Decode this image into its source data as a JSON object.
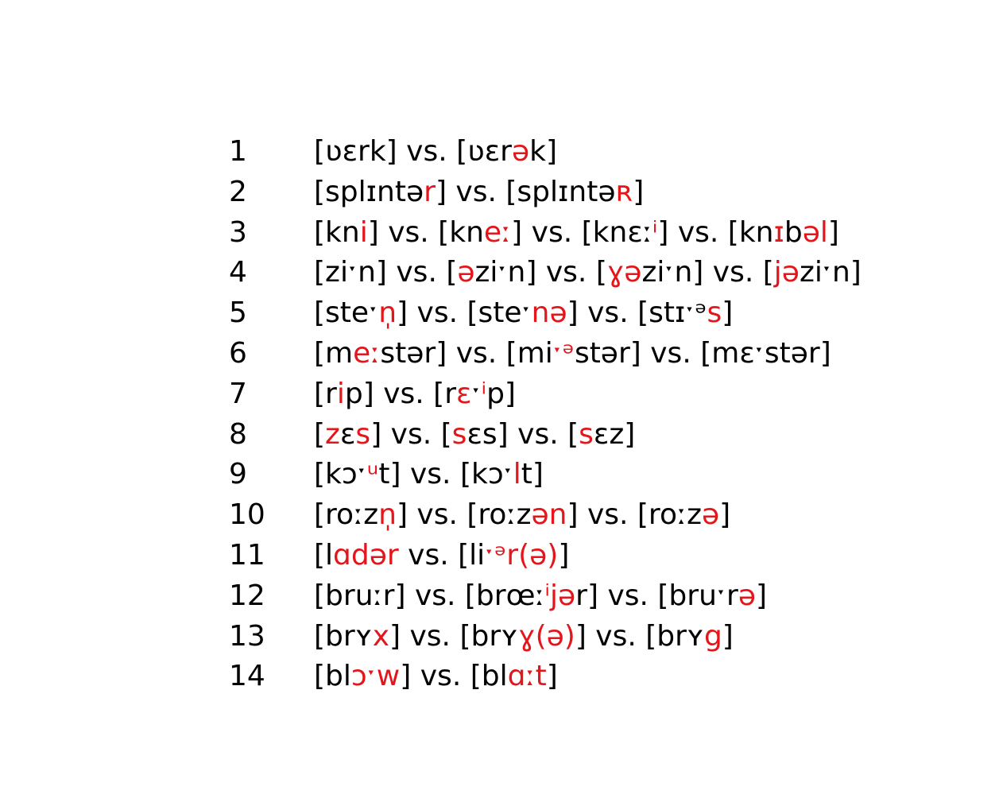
{
  "highlight_color": "#e4161b",
  "text_color": "#000000",
  "rows": [
    {
      "n": "1",
      "segs": [
        [
          "[ʋɛrk]",
          0
        ],
        [
          " vs. ",
          0
        ],
        [
          "[ʋɛr",
          0
        ],
        [
          "ə",
          1
        ],
        [
          "k]",
          0
        ]
      ]
    },
    {
      "n": "2",
      "segs": [
        [
          "[splɪntə",
          0
        ],
        [
          "r",
          1
        ],
        [
          "]",
          0
        ],
        [
          " vs. ",
          0
        ],
        [
          "[splɪntə",
          0
        ],
        [
          "ʀ",
          1
        ],
        [
          "]",
          0
        ]
      ]
    },
    {
      "n": "3",
      "segs": [
        [
          "[kn",
          0
        ],
        [
          "i",
          1
        ],
        [
          "]",
          0
        ],
        [
          " vs. ",
          0
        ],
        [
          "[kn",
          0
        ],
        [
          "eː",
          1
        ],
        [
          "]",
          0
        ],
        [
          " vs. ",
          0
        ],
        [
          "[knɛː",
          0
        ],
        [
          "ⁱ",
          1
        ],
        [
          "]",
          0
        ],
        [
          " vs. ",
          0
        ],
        [
          "[kn",
          0
        ],
        [
          "ɪ",
          1
        ],
        [
          "b",
          0
        ],
        [
          "əl",
          1
        ],
        [
          "]",
          0
        ]
      ]
    },
    {
      "n": "4",
      "segs": [
        [
          "[ziˑn]",
          0
        ],
        [
          " vs. ",
          0
        ],
        [
          "[",
          0
        ],
        [
          "ə",
          1
        ],
        [
          "ziˑn]",
          0
        ],
        [
          " vs. ",
          0
        ],
        [
          "[",
          0
        ],
        [
          "ɣə",
          1
        ],
        [
          "ziˑn]",
          0
        ],
        [
          " vs. ",
          0
        ],
        [
          "[",
          0
        ],
        [
          "jə",
          1
        ],
        [
          "ziˑn]",
          0
        ]
      ]
    },
    {
      "n": "5",
      "segs": [
        [
          "[steˑ",
          0
        ],
        [
          "n̩",
          1
        ],
        [
          "]",
          0
        ],
        [
          " vs. ",
          0
        ],
        [
          "[steˑ",
          0
        ],
        [
          "nə",
          1
        ],
        [
          "]",
          0
        ],
        [
          " vs. ",
          0
        ],
        [
          "[stɪˑᵊ",
          0
        ],
        [
          "s",
          1
        ],
        [
          "]",
          0
        ]
      ]
    },
    {
      "n": "6",
      "segs": [
        [
          "[m",
          0
        ],
        [
          "eː",
          1
        ],
        [
          "stər]",
          0
        ],
        [
          " vs. ",
          0
        ],
        [
          "[mi",
          0
        ],
        [
          "ˑᵊ",
          1
        ],
        [
          "stər]",
          0
        ],
        [
          " vs. ",
          0
        ],
        [
          "[mɛˑstər]",
          0
        ]
      ]
    },
    {
      "n": "7",
      "segs": [
        [
          "[r",
          0
        ],
        [
          "i",
          1
        ],
        [
          "p]",
          0
        ],
        [
          " vs. ",
          0
        ],
        [
          "[r",
          0
        ],
        [
          "ɛ",
          1
        ],
        [
          "ˑ",
          0
        ],
        [
          "ⁱ",
          1
        ],
        [
          "p]",
          0
        ]
      ]
    },
    {
      "n": "8",
      "segs": [
        [
          "[",
          0
        ],
        [
          "z",
          1
        ],
        [
          "ɛ",
          0
        ],
        [
          "s",
          1
        ],
        [
          "]",
          0
        ],
        [
          " vs. ",
          0
        ],
        [
          "[",
          0
        ],
        [
          "s",
          1
        ],
        [
          "ɛs]",
          0
        ],
        [
          " vs. ",
          0
        ],
        [
          "[",
          0
        ],
        [
          "s",
          1
        ],
        [
          "ɛz]",
          0
        ]
      ]
    },
    {
      "n": "9",
      "segs": [
        [
          "[kɔˑ",
          0
        ],
        [
          "ᵘ",
          1
        ],
        [
          "t]",
          0
        ],
        [
          " vs. ",
          0
        ],
        [
          "[kɔˑ",
          0
        ],
        [
          "l",
          1
        ],
        [
          "t]",
          0
        ]
      ]
    },
    {
      "n": "10",
      "segs": [
        [
          "[roːz",
          0
        ],
        [
          "n̩",
          1
        ],
        [
          "]",
          0
        ],
        [
          " vs. ",
          0
        ],
        [
          "[roːz",
          0
        ],
        [
          "ən",
          1
        ],
        [
          "]",
          0
        ],
        [
          " vs. ",
          0
        ],
        [
          "[roːz",
          0
        ],
        [
          "ə",
          1
        ],
        [
          "]",
          0
        ]
      ]
    },
    {
      "n": "11",
      "segs": [
        [
          "[l",
          0
        ],
        [
          "ɑdər",
          1
        ],
        [
          " vs. ",
          0
        ],
        [
          "[li",
          0
        ],
        [
          "ˑᵊr(ə)",
          1
        ],
        [
          "]",
          0
        ]
      ]
    },
    {
      "n": "12",
      "segs": [
        [
          "[bruːr]",
          0
        ],
        [
          " vs. ",
          0
        ],
        [
          "[brœː",
          0
        ],
        [
          "ⁱjə",
          1
        ],
        [
          "r]",
          0
        ],
        [
          " vs. ",
          0
        ],
        [
          "[bruˑr",
          0
        ],
        [
          "ə",
          1
        ],
        [
          "]",
          0
        ]
      ]
    },
    {
      "n": "13",
      "segs": [
        [
          "[brʏ",
          0
        ],
        [
          "x",
          1
        ],
        [
          "]",
          0
        ],
        [
          " vs. ",
          0
        ],
        [
          "[brʏ",
          0
        ],
        [
          "ɣ(ə)",
          1
        ],
        [
          "]",
          0
        ],
        [
          " vs. ",
          0
        ],
        [
          "[brʏ",
          0
        ],
        [
          "g",
          1
        ],
        [
          "]",
          0
        ]
      ]
    },
    {
      "n": "14",
      "segs": [
        [
          "[bl",
          0
        ],
        [
          "ɔˑw",
          1
        ],
        [
          "]",
          0
        ],
        [
          " vs. ",
          0
        ],
        [
          "[bl",
          0
        ],
        [
          "ɑːt",
          1
        ],
        [
          "]",
          0
        ]
      ]
    }
  ]
}
